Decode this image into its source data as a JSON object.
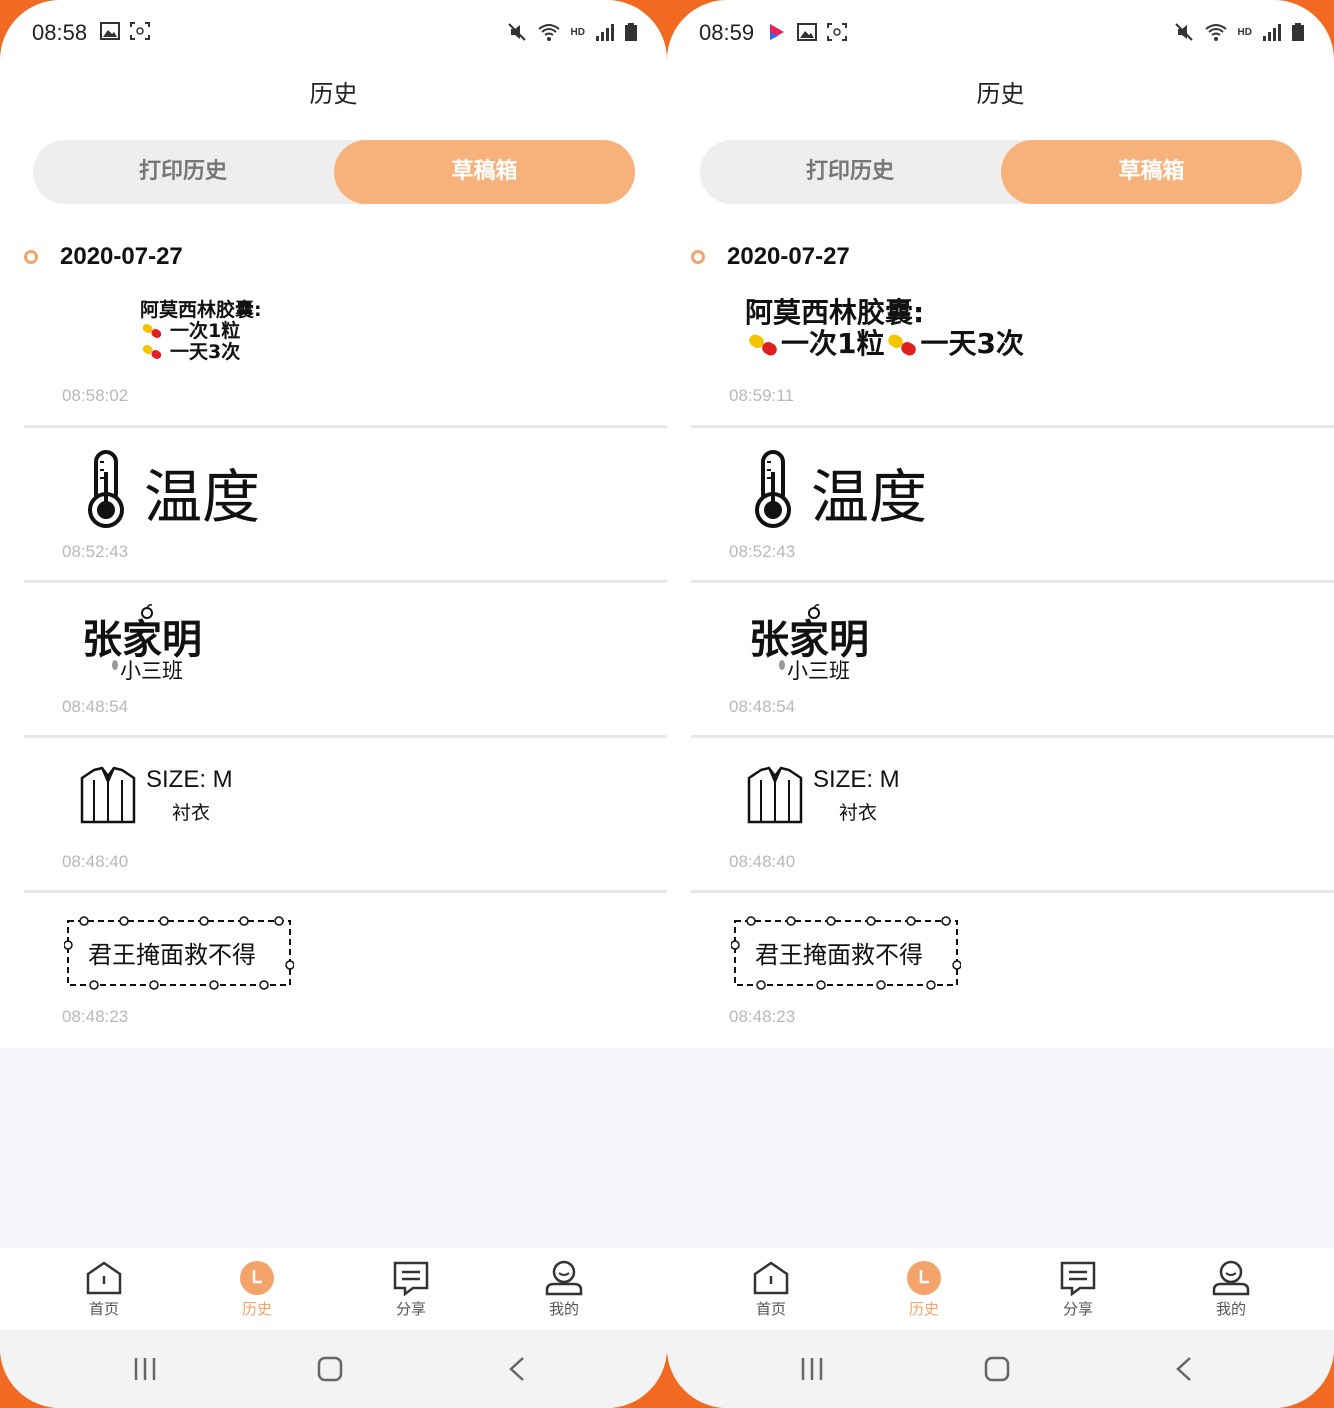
{
  "phones": [
    {
      "status": {
        "time": "08:58"
      },
      "title": "历史",
      "segment": {
        "tab1": "打印历史",
        "tab2": "草稿箱"
      },
      "date": "2020-07-27",
      "items": [
        {
          "med_title": "阿莫西林胶囊:",
          "med_line1": "一次1粒",
          "med_line2": "一天3次",
          "time": "08:58:02"
        },
        {
          "text": "温度",
          "time": "08:52:43"
        },
        {
          "name": "张家明",
          "sub": "小三班",
          "time": "08:48:54"
        },
        {
          "size": "SIZE: M",
          "sub": "衬衣",
          "time": "08:48:40"
        },
        {
          "poem": "君王掩面救不得",
          "time": "08:48:23"
        }
      ],
      "tabs": [
        {
          "label": "首页",
          "icon": "home-icon"
        },
        {
          "label": "历史",
          "icon": "clock-icon"
        },
        {
          "label": "分享",
          "icon": "share-icon"
        },
        {
          "label": "我的",
          "icon": "user-icon"
        }
      ]
    },
    {
      "status": {
        "time": "08:59"
      },
      "title": "历史",
      "segment": {
        "tab1": "打印历史",
        "tab2": "草稿箱"
      },
      "date": "2020-07-27",
      "items": [
        {
          "med_title": "阿莫西林胶囊:",
          "med_line1": "一次1粒",
          "med_line2": "一天3次",
          "time": "08:59:11"
        },
        {
          "text": "温度",
          "time": "08:52:43"
        },
        {
          "name": "张家明",
          "sub": "小三班",
          "time": "08:48:54"
        },
        {
          "size": "SIZE: M",
          "sub": "衬衣",
          "time": "08:48:40"
        },
        {
          "poem": "君王掩面救不得",
          "time": "08:48:23"
        }
      ],
      "tabs": [
        {
          "label": "首页",
          "icon": "home-icon"
        },
        {
          "label": "历史",
          "icon": "clock-icon"
        },
        {
          "label": "分享",
          "icon": "share-icon"
        },
        {
          "label": "我的",
          "icon": "user-icon"
        }
      ]
    }
  ],
  "colors": {
    "accent": "#f7b27c",
    "accent_dark": "#f4a36b",
    "background": "#f26a21"
  }
}
